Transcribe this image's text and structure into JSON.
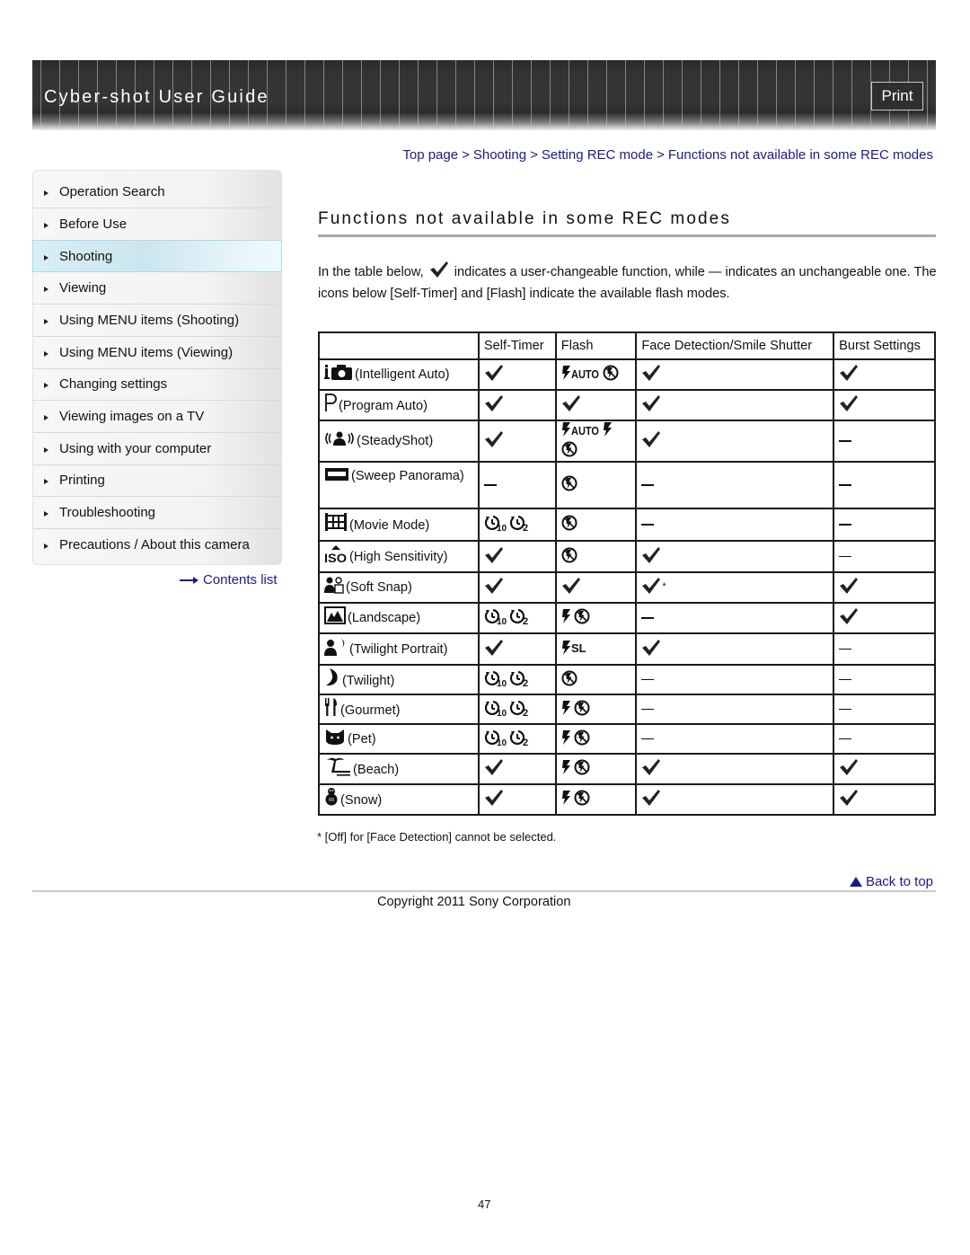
{
  "header": {
    "title": "Cyber-shot User Guide",
    "print_label": "Print"
  },
  "breadcrumb": [
    {
      "label": "Top page"
    },
    {
      "label": "Shooting"
    },
    {
      "label": "Setting REC mode"
    },
    {
      "label": "Functions not available in some REC modes"
    }
  ],
  "breadcrumb_separator": ">",
  "sidebar": {
    "items": [
      {
        "label": "Operation Search",
        "active": false
      },
      {
        "label": "Before Use",
        "active": false
      },
      {
        "label": "Shooting",
        "active": true
      },
      {
        "label": "Viewing",
        "active": false
      },
      {
        "label": "Using MENU items (Shooting)",
        "active": false
      },
      {
        "label": "Using MENU items (Viewing)",
        "active": false
      },
      {
        "label": "Changing settings",
        "active": false
      },
      {
        "label": "Viewing images on a TV",
        "active": false
      },
      {
        "label": "Using with your computer",
        "active": false
      },
      {
        "label": "Printing",
        "active": false
      },
      {
        "label": "Troubleshooting",
        "active": false
      },
      {
        "label": "Precautions / About this camera",
        "active": false
      }
    ],
    "contents_list_label": "Contents list"
  },
  "main": {
    "title": "Functions not available in some REC modes",
    "intro_part1": "In the table below,",
    "intro_part2": "indicates a user-changeable function, while — indicates an unchangeable one. The icons below [Self-Timer] and [Flash] indicate the available flash modes.",
    "table": {
      "headers": [
        "",
        "Self-Timer",
        "Flash",
        "Face Detection/Smile Shutter",
        "Burst Settings"
      ],
      "rows": [
        {
          "icon": "intelligent-auto-icon",
          "mode": "(Intelligent Auto)",
          "self_timer": [
            "check"
          ],
          "flash": [
            "flash-auto",
            "flash-off"
          ],
          "face": "check",
          "burst": "check"
        },
        {
          "icon": "program-auto-icon",
          "mode": "(Program Auto)",
          "self_timer": [
            "check"
          ],
          "flash": [
            "check"
          ],
          "face": "check",
          "burst": "check"
        },
        {
          "icon": "steadyshot-icon",
          "mode": "(SteadyShot)",
          "self_timer": [
            "check"
          ],
          "flash": [
            "flash-auto",
            "flash-on",
            "flash-off"
          ],
          "face": "check",
          "burst": "dash"
        },
        {
          "icon": "sweep-panorama-icon",
          "mode": "(Sweep Panorama)",
          "self_timer": [
            "dash"
          ],
          "flash": [
            "flash-off"
          ],
          "face": "dash",
          "burst": "dash"
        },
        {
          "icon": "movie-mode-icon",
          "mode": "(Movie Mode)",
          "self_timer": [
            "timer-10",
            "timer-2"
          ],
          "flash": [
            "flash-off"
          ],
          "face": "dash",
          "burst": "dash"
        },
        {
          "icon": "high-sensitivity-icon",
          "mode": "(High Sensitivity)",
          "self_timer": [
            "check"
          ],
          "flash": [
            "flash-off"
          ],
          "face": "check",
          "burst": "dash"
        },
        {
          "icon": "soft-snap-icon",
          "mode": "(Soft Snap)",
          "self_timer": [
            "check"
          ],
          "flash": [
            "check"
          ],
          "face": "check*",
          "burst": "check"
        },
        {
          "icon": "landscape-icon",
          "mode": "(Landscape)",
          "self_timer": [
            "timer-10",
            "timer-2"
          ],
          "flash": [
            "flash-on",
            "flash-off"
          ],
          "face": "dash",
          "burst": "check"
        },
        {
          "icon": "twilight-portrait-icon",
          "mode": "(Twilight Portrait)",
          "self_timer": [
            "check"
          ],
          "flash": [
            "flash-slow-sync"
          ],
          "face": "check",
          "burst": "dash"
        },
        {
          "icon": "twilight-icon",
          "mode": "(Twilight)",
          "self_timer": [
            "timer-10",
            "timer-2"
          ],
          "flash": [
            "flash-off"
          ],
          "face": "dash",
          "burst": "dash"
        },
        {
          "icon": "gourmet-icon",
          "mode": "(Gourmet)",
          "self_timer": [
            "timer-10",
            "timer-2"
          ],
          "flash": [
            "flash-on",
            "flash-off"
          ],
          "face": "dash",
          "burst": "dash"
        },
        {
          "icon": "pet-icon",
          "mode": "(Pet)",
          "self_timer": [
            "timer-10",
            "timer-2"
          ],
          "flash": [
            "flash-on",
            "flash-off"
          ],
          "face": "dash",
          "burst": "dash"
        },
        {
          "icon": "beach-icon",
          "mode": "(Beach)",
          "self_timer": [
            "check"
          ],
          "flash": [
            "flash-on",
            "flash-off"
          ],
          "face": "check",
          "burst": "check"
        },
        {
          "icon": "snow-icon",
          "mode": "(Snow)",
          "self_timer": [
            "check"
          ],
          "flash": [
            "flash-on",
            "flash-off"
          ],
          "face": "check",
          "burst": "check"
        }
      ]
    },
    "footnote": "* [Off] for [Face Detection] cannot be selected.",
    "back_to_top_label": "Back to top"
  },
  "footer": {
    "copyright": "Copyright 2011 Sony Corporation",
    "page_number": "47"
  },
  "colors": {
    "link": "#1a1a8c",
    "header_bg": "#333333",
    "active_nav_bg": "#d8eef3",
    "active_nav_border": "#9fdcef"
  }
}
